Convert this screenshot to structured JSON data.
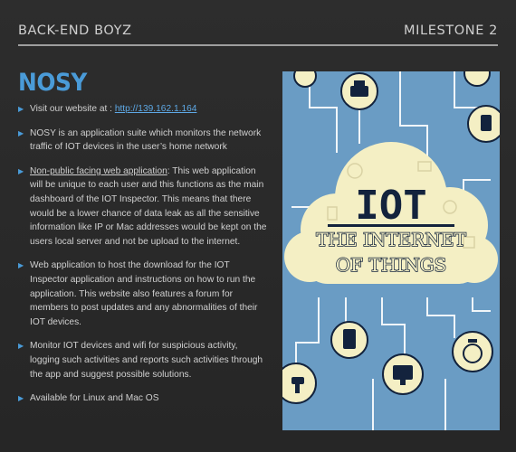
{
  "header": {
    "left": "BACK-END BOYZ",
    "right": "MILESTONE 2"
  },
  "title": "NOSY",
  "bullets": [
    {
      "prefix": "Visit our website at : ",
      "link": "http://139.162.1.164",
      "text": ""
    },
    {
      "text": "NOSY is an application suite which monitors the network traffic of IOT devices in the user’s home network"
    },
    {
      "underlined": "Non-public facing web application",
      "text": ": This web application will be unique to each user and this functions as the main dashboard of the IOT Inspector.  This means that there would be a lower chance of data leak as all the sensitive information like IP or Mac addresses would be kept on the users local server and not be upload to the internet."
    },
    {
      "text": "Web application to host the download for the IOT Inspector application and instructions on how to run the application. This website also features a forum for members to post updates and any abnormalities of their IOT devices."
    },
    {
      "text": "Monitor IOT devices and wifi for suspicious activity, logging such activities and reports such activities through the app and suggest possible solutions."
    },
    {
      "text": "Available for Linux and Mac OS"
    }
  ],
  "image": {
    "heading": "IOT",
    "line1": "THE INTERNET",
    "line2": "OF THINGS",
    "colors": {
      "bg": "#6a9cc4",
      "cloud": "#f4efc4",
      "node": "#13233d",
      "wire": "#ffffff"
    }
  }
}
